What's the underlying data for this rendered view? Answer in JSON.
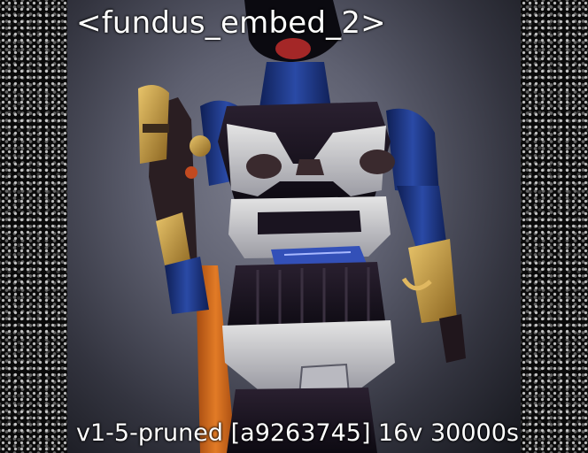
{
  "overlay": {
    "title": "<fundus_embed_2>",
    "footer": "v1-5-pruned [a9263745]  16v 30000s"
  },
  "colors": {
    "background": "#000000",
    "text": "#ffffff",
    "armor_white": "#d6d6d6",
    "armor_blue": "#1d3a8a",
    "armor_dark": "#1a1420",
    "accent_orange": "#d9701f",
    "accent_gold": "#c79a3a"
  }
}
